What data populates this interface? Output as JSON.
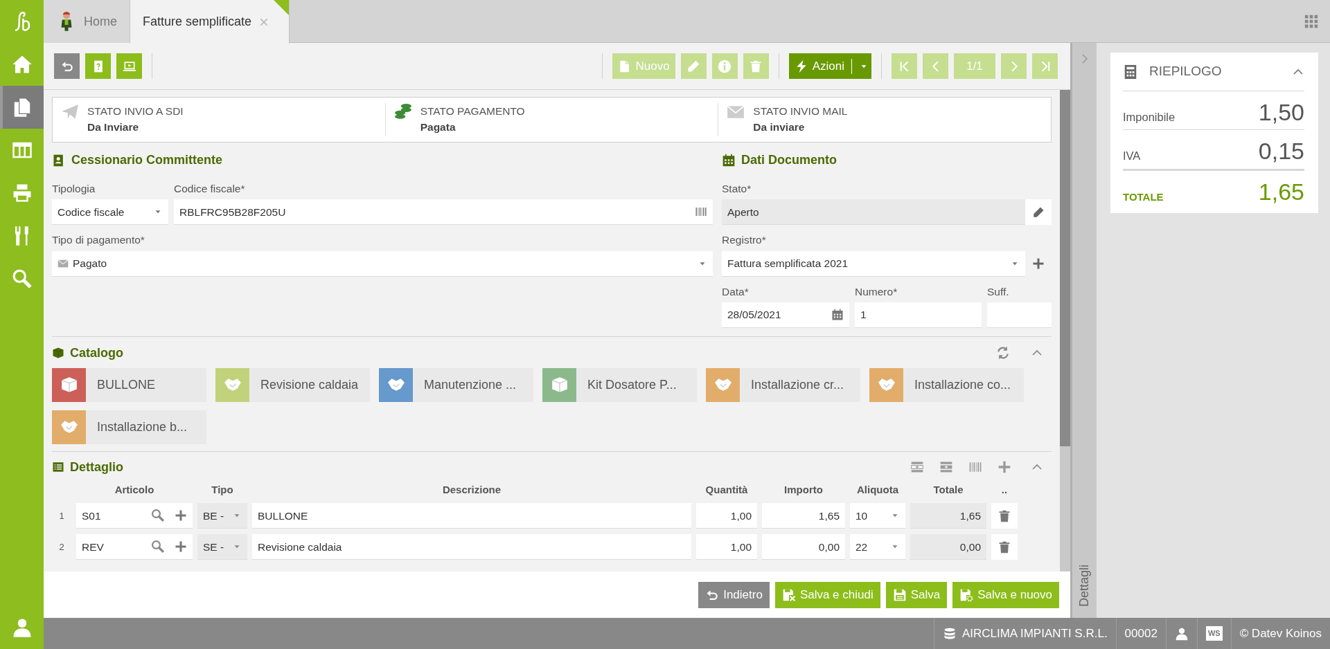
{
  "sidebar": {
    "items": [
      {
        "kind": "home",
        "selected": false
      },
      {
        "kind": "documents",
        "selected": true
      },
      {
        "kind": "table",
        "selected": false
      },
      {
        "kind": "printer",
        "selected": false
      },
      {
        "kind": "tools",
        "selected": false
      },
      {
        "kind": "search",
        "selected": false
      }
    ]
  },
  "tabs": [
    {
      "label": "Home",
      "selected": false,
      "closable": false
    },
    {
      "label": "Fatture semplificate",
      "selected": true,
      "closable": true
    }
  ],
  "toolbar": {
    "left": [
      {
        "kind": "back"
      },
      {
        "kind": "help"
      },
      {
        "kind": "video"
      }
    ],
    "record": [
      {
        "kind": "new",
        "label": "Nuovo",
        "disabled": true
      },
      {
        "kind": "edit",
        "disabled": true
      },
      {
        "kind": "info",
        "disabled": true
      },
      {
        "kind": "delete",
        "disabled": true
      }
    ],
    "actions": {
      "label": "Azioni"
    },
    "pager": [
      {
        "kind": "first",
        "disabled": true
      },
      {
        "kind": "prev",
        "disabled": true
      },
      {
        "kind": "page",
        "label": "1/1",
        "disabled": true
      },
      {
        "kind": "next",
        "disabled": true
      },
      {
        "kind": "last",
        "disabled": true
      }
    ]
  },
  "status": [
    {
      "kind": "sdi",
      "title": "STATO INVIO A SDI",
      "value": "Da Inviare"
    },
    {
      "kind": "payment",
      "title": "STATO PAGAMENTO",
      "value": "Pagata"
    },
    {
      "kind": "mail",
      "title": "STATO INVIO MAIL",
      "value": "Da inviare"
    }
  ],
  "customer": {
    "title": "Cessionario Committente",
    "tipologia": {
      "label": "Tipologia",
      "value": "Codice fiscale"
    },
    "codice_fiscale": {
      "label": "Codice fiscale*",
      "value": "RBLFRC95B28F205U"
    },
    "pagamento": {
      "label": "Tipo di pagamento*",
      "value": "Pagato"
    }
  },
  "document": {
    "title": "Dati Documento",
    "stato": {
      "label": "Stato*",
      "value": "Aperto",
      "disabled": true
    },
    "registro": {
      "label": "Registro*",
      "value": "Fattura semplificata 2021"
    },
    "data": {
      "label": "Data*",
      "value": "28/05/2021"
    },
    "numero": {
      "label": "Numero*",
      "value": "1"
    },
    "suffisso": {
      "label": "Suff."
    }
  },
  "catalog": {
    "title": "Catalogo",
    "items": [
      {
        "label": "BULLONE",
        "kind": "product",
        "color": "#cd5f59"
      },
      {
        "label": "Revisione caldaia",
        "kind": "service",
        "color": "#c2d27b"
      },
      {
        "label": "Manutenzione ...",
        "kind": "service",
        "color": "#6699cc"
      },
      {
        "label": "Kit Dosatore P...",
        "kind": "product",
        "color": "#8bb98b"
      },
      {
        "label": "Installazione cr...",
        "kind": "service",
        "color": "#e2ad6b"
      },
      {
        "label": "Installazione co...",
        "kind": "service",
        "color": "#e2ad6b"
      },
      {
        "label": "Installazione b...",
        "kind": "service",
        "color": "#e2ad6b"
      }
    ]
  },
  "detail": {
    "title": "Dettaglio",
    "columns": [
      "Articolo",
      "Tipo",
      "Descrizione",
      "Quantità",
      "Importo",
      "Aliquota",
      "Totale",
      ".."
    ],
    "rows": [
      {
        "number": "1",
        "articolo": "S01",
        "tipo": "BE -",
        "descrizione": "BULLONE",
        "quantita": "1,00",
        "importo": "1,65",
        "aliquota": "10",
        "totale": "1,65"
      },
      {
        "number": "2",
        "articolo": "REV",
        "tipo": "SE -",
        "descrizione": "Revisione caldaia",
        "quantita": "1,00",
        "importo": "0,00",
        "aliquota": "22",
        "totale": "0,00"
      }
    ]
  },
  "footer_buttons": [
    {
      "kind": "back",
      "label": "Indietro"
    },
    {
      "kind": "save_close",
      "label": "Salva e chiudi"
    },
    {
      "kind": "save",
      "label": "Salva"
    },
    {
      "kind": "save_new",
      "label": "Salva e nuovo"
    }
  ],
  "side_panel": {
    "label": "Dettagli"
  },
  "summary": {
    "title": "RIEPILOGO",
    "rows": [
      {
        "kind": "amount",
        "label": "Imponibile",
        "value": "1,50"
      },
      {
        "kind": "amount",
        "label": "IVA",
        "value": "0,15"
      },
      {
        "kind": "total",
        "label": "TOTALE",
        "value": "1,65"
      }
    ]
  },
  "status_bar": {
    "company": "AIRCLIMA IMPIANTI S.R.L.",
    "code": "00002",
    "badge": "WS",
    "copyright": "© Datev Koinos"
  }
}
